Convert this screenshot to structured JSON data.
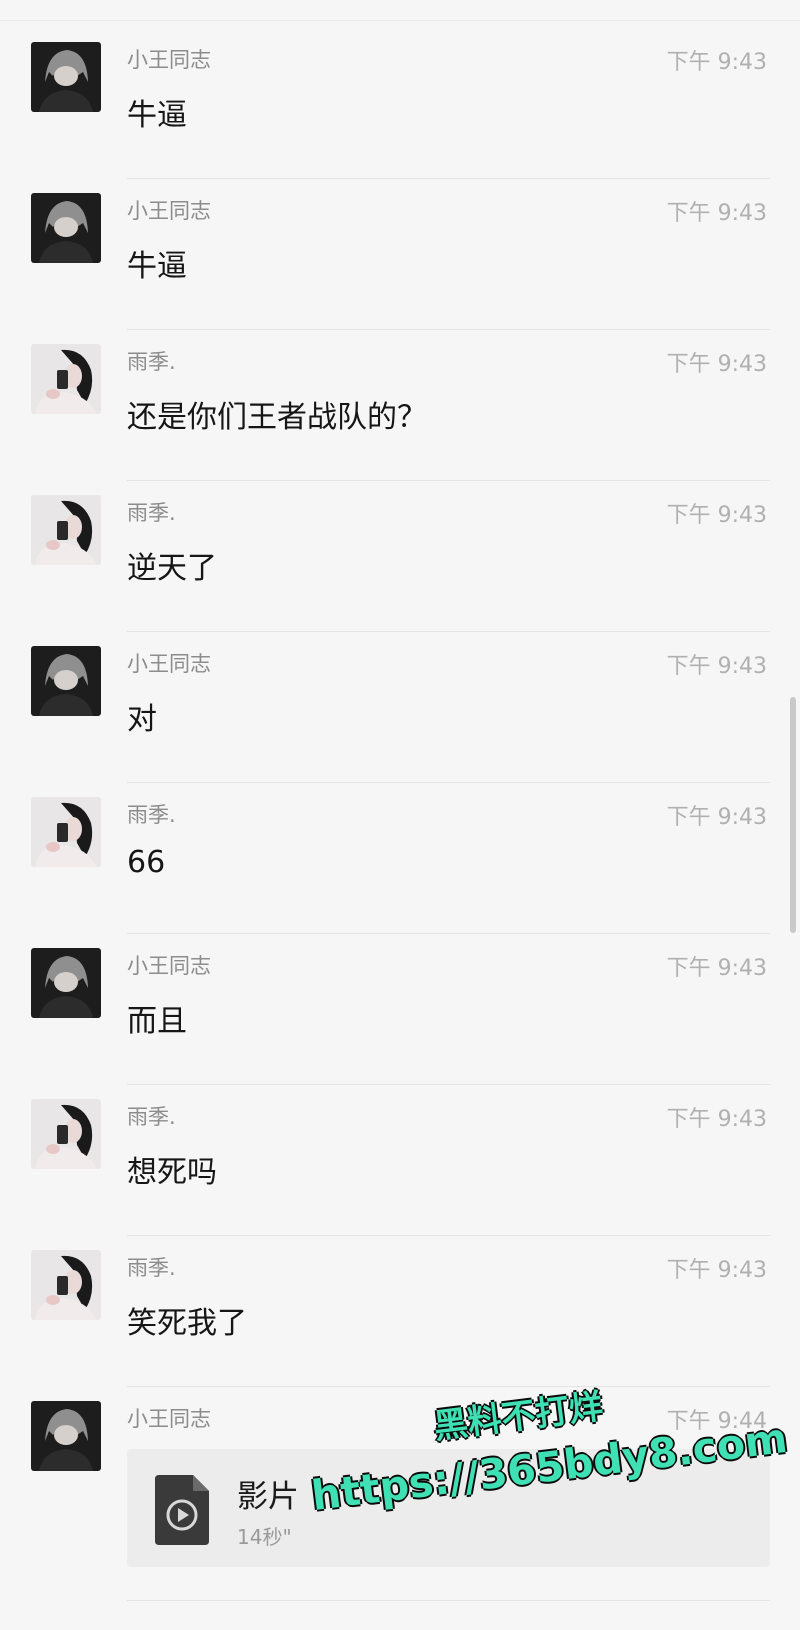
{
  "messages": [
    {
      "sender": "小王同志",
      "time": "下午 9:43",
      "text": "牛逼",
      "avatar": "wang"
    },
    {
      "sender": "小王同志",
      "time": "下午 9:43",
      "text": "牛逼",
      "avatar": "wang"
    },
    {
      "sender": "雨季.",
      "time": "下午 9:43",
      "text": "还是你们王者战队的？",
      "avatar": "yuji"
    },
    {
      "sender": "雨季.",
      "time": "下午 9:43",
      "text": "逆天了",
      "avatar": "yuji"
    },
    {
      "sender": "小王同志",
      "time": "下午 9:43",
      "text": "对",
      "avatar": "wang"
    },
    {
      "sender": "雨季.",
      "time": "下午 9:43",
      "text": "66",
      "avatar": "yuji"
    },
    {
      "sender": "小王同志",
      "time": "下午 9:43",
      "text": "而且",
      "avatar": "wang"
    },
    {
      "sender": "雨季.",
      "time": "下午 9:43",
      "text": "想死吗",
      "avatar": "yuji"
    },
    {
      "sender": "雨季.",
      "time": "下午 9:43",
      "text": "笑死我了",
      "avatar": "yuji"
    }
  ],
  "file_message": {
    "sender": "小王同志",
    "time": "下午 9:44",
    "file_name": "影片",
    "duration": "14秒\"",
    "icon": "video-file-icon"
  },
  "watermark": {
    "line1": "黑料不打烊",
    "line2": "https://365bdy8.com"
  },
  "colors": {
    "background": "#f6f6f6",
    "watermark": "#3fe0b3"
  }
}
